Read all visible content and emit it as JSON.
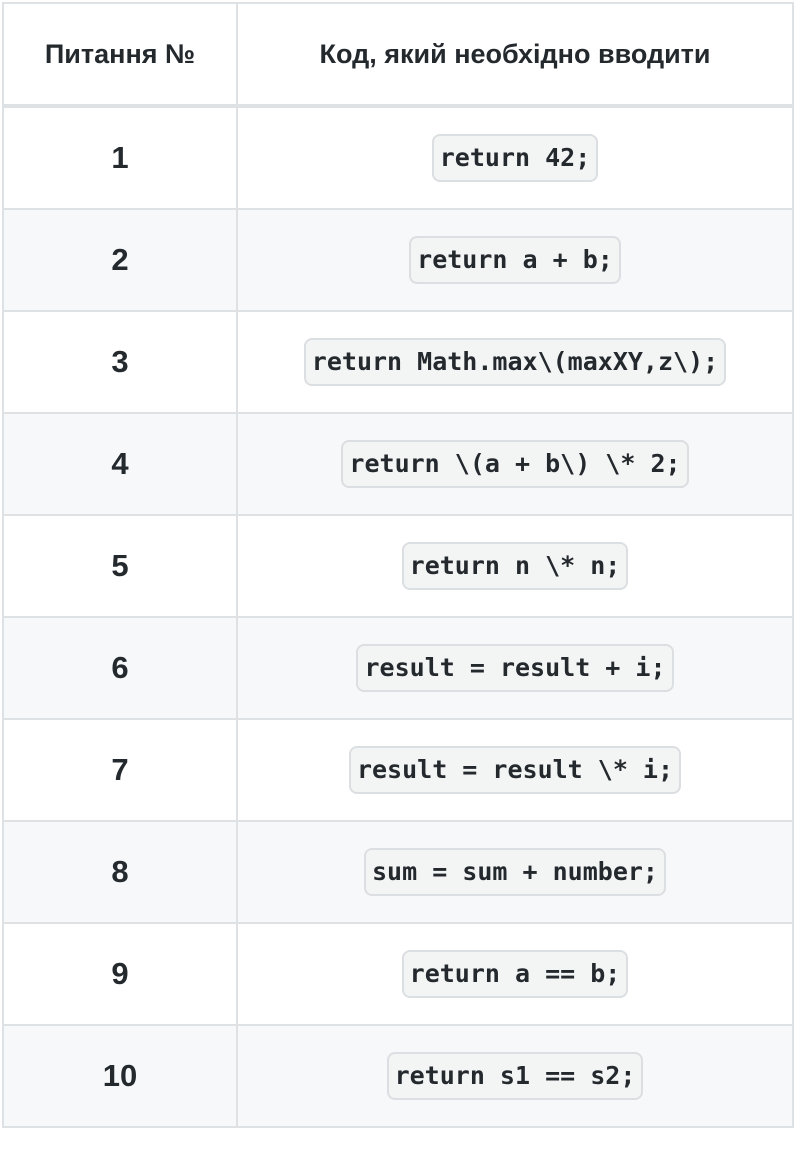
{
  "table": {
    "headers": [
      "Питання №",
      "Код, який необхідно вводити"
    ],
    "rows": [
      {
        "number": "1",
        "code": "return 42;"
      },
      {
        "number": "2",
        "code": "return a + b;"
      },
      {
        "number": "3",
        "code": "return Math.max\\(maxXY,z\\);"
      },
      {
        "number": "4",
        "code": "return \\(a + b\\) \\* 2;"
      },
      {
        "number": "5",
        "code": "return n \\* n;"
      },
      {
        "number": "6",
        "code": "result = result + i;"
      },
      {
        "number": "7",
        "code": "result = result \\* i;"
      },
      {
        "number": "8",
        "code": "sum = sum + number;"
      },
      {
        "number": "9",
        "code": "return a == b;"
      },
      {
        "number": "10",
        "code": "return s1 == s2;"
      }
    ]
  }
}
